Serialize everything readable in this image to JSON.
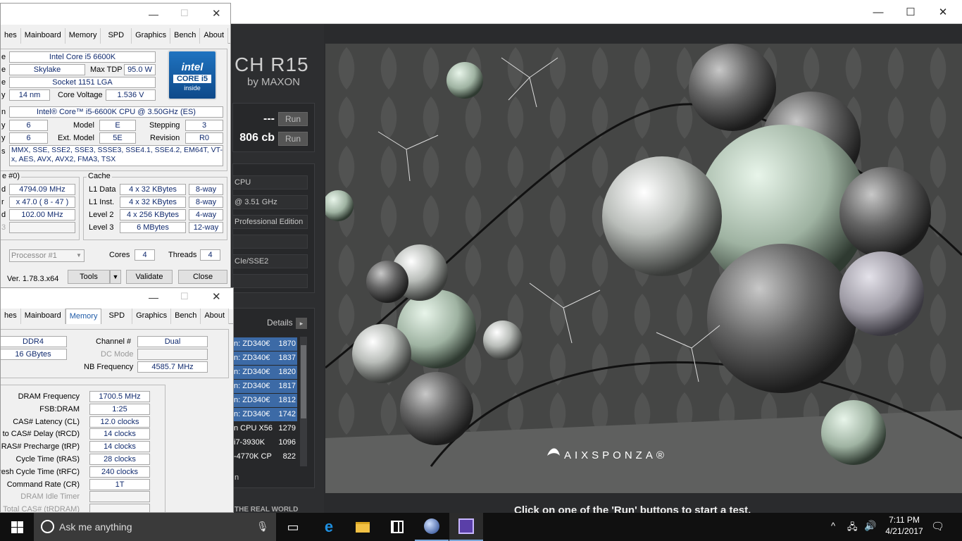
{
  "cinebench": {
    "logo": "CH R15",
    "logo_sub": "by MAXON",
    "results": [
      {
        "value": "---",
        "run": "Run"
      },
      {
        "value": "806 cb",
        "run": "Run"
      }
    ],
    "system": [
      "CPU",
      "@ 3.51 GHz",
      "Professional Edition",
      "",
      "CIe/SSE2",
      ""
    ],
    "details_label": "Details",
    "ranking": [
      {
        "name": "n: ZD340€",
        "score": "1870",
        "hl": true
      },
      {
        "name": "n: ZD340€",
        "score": "1837",
        "hl": true
      },
      {
        "name": "n: ZD340€",
        "score": "1820",
        "hl": true
      },
      {
        "name": "n: ZD340€",
        "score": "1817",
        "hl": true
      },
      {
        "name": "n: ZD340€",
        "score": "1812",
        "hl": true
      },
      {
        "name": "n: ZD340€",
        "score": "1742",
        "hl": true
      },
      {
        "name": "n CPU X56",
        "score": "1279",
        "hl": false
      },
      {
        "name": "i7-3930K",
        "score": "1096",
        "hl": false
      },
      {
        "name": "-4770K CP",
        "score": "822",
        "hl": false
      }
    ],
    "ranking_tail": "n",
    "footer_left": "THE REAL WORLD",
    "footer_msg": "Click on one of the 'Run' buttons to start a test.",
    "brand": "AIXSPONZA®"
  },
  "cpuz1": {
    "tabs": [
      "hes",
      "Mainboard",
      "Memory",
      "SPD",
      "Graphics",
      "Bench",
      "About"
    ],
    "name_lbl": "e",
    "name": "Intel Core i5 6600K",
    "code_lbl": "e",
    "codename": "Skylake",
    "tdp_lbl": "Max TDP",
    "tdp": "95.0 W",
    "pkg_lbl": "e",
    "package": "Socket 1151 LGA",
    "tech_lbl": "y",
    "technology": "14 nm",
    "volt_lbl": "Core Voltage",
    "voltage": "1.536 V",
    "spec_lbl": "n",
    "spec": "Intel® Core™ i5-6600K CPU @ 3.50GHz (ES)",
    "fam_lbl": "y",
    "family": "6",
    "model_lbl": "Model",
    "model": "E",
    "step_lbl": "Stepping",
    "stepping": "3",
    "extfam_lbl": "y",
    "ext_family": "6",
    "extmodel_lbl": "Ext. Model",
    "ext_model": "5E",
    "rev_lbl": "Revision",
    "revision": "R0",
    "inst_lbl": "s",
    "instructions": "MMX, SSE, SSE2, SSE3, SSSE3, SSE4.1, SSE4.2, EM64T, VT-x, AES, AVX, AVX2, FMA3, TSX",
    "clocks_title": "e #0)",
    "clk_lbls": [
      "d",
      "r",
      "d",
      "3"
    ],
    "core_speed": "4794.09 MHz",
    "multiplier": "x 47.0 ( 8 - 47 )",
    "bus_speed": "102.00 MHz",
    "rated_fsb": "",
    "cache_title": "Cache",
    "cache": [
      {
        "l": "L1 Data",
        "v": "4 x 32 KBytes",
        "w": "8-way"
      },
      {
        "l": "L1 Inst.",
        "v": "4 x 32 KBytes",
        "w": "8-way"
      },
      {
        "l": "Level 2",
        "v": "4 x 256 KBytes",
        "w": "4-way"
      },
      {
        "l": "Level 3",
        "v": "6 MBytes",
        "w": "12-way"
      }
    ],
    "selection": "Processor #1",
    "cores_lbl": "Cores",
    "cores": "4",
    "threads_lbl": "Threads",
    "threads": "4",
    "version": "Ver. 1.78.3.x64",
    "tools": "Tools",
    "validate": "Validate",
    "close": "Close",
    "intel_badge": {
      "top": "intel",
      "mid": "CORE i5",
      "bot": "inside"
    }
  },
  "cpuz2": {
    "tabs": [
      "hes",
      "Mainboard",
      "Memory",
      "SPD",
      "Graphics",
      "Bench",
      "About"
    ],
    "type": "DDR4",
    "size": "16 GBytes",
    "channel_lbl": "Channel #",
    "channel": "Dual",
    "dcmode_lbl": "DC Mode",
    "dcmode": "",
    "nbfreq_lbl": "NB Frequency",
    "nbfreq": "4585.7 MHz",
    "timings": [
      {
        "l": "DRAM Frequency",
        "v": "1700.5 MHz"
      },
      {
        "l": "FSB:DRAM",
        "v": "1:25"
      },
      {
        "l": "CAS# Latency (CL)",
        "v": "12.0 clocks"
      },
      {
        "l": "# to CAS# Delay (tRCD)",
        "v": "14 clocks"
      },
      {
        "l": "RAS# Precharge (tRP)",
        "v": "14 clocks"
      },
      {
        "l": "Cycle Time (tRAS)",
        "v": "28 clocks"
      },
      {
        "l": "fresh Cycle Time (tRFC)",
        "v": "240 clocks"
      },
      {
        "l": "Command Rate (CR)",
        "v": "1T"
      },
      {
        "l": "DRAM Idle Timer",
        "v": ""
      },
      {
        "l": "Total CAS# (tRDRAM)",
        "v": ""
      }
    ]
  },
  "taskbar": {
    "search_placeholder": "Ask me anything",
    "time": "7:11 PM",
    "date": "4/21/2017"
  }
}
